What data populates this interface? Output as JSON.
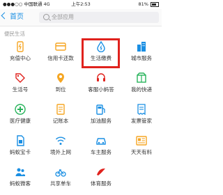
{
  "status_bar": {
    "carrier": "中国联通",
    "network": "4G",
    "time": "上午2:53",
    "battery": "81%"
  },
  "nav": {
    "back_label": "首页",
    "search_placeholder": "全部应用"
  },
  "section": {
    "title": "便民生活"
  },
  "colors": {
    "accent": "#1a8fe3",
    "orange": "#f5a623",
    "red": "#e0221d",
    "green": "#27b35b",
    "highlight": "#e0221d"
  },
  "apps": [
    {
      "label": "充值中心",
      "icon": "phone-charge-icon",
      "color": "#f5a623"
    },
    {
      "label": "信用卡还款",
      "icon": "credit-card-icon",
      "color": "#f5a623"
    },
    {
      "label": "生活缴费",
      "icon": "water-drop-icon",
      "color": "#1a8fe3"
    },
    {
      "label": "城市服务",
      "icon": "city-building-icon",
      "color": "#1a8fe3"
    },
    {
      "label": "生活号",
      "icon": "tag-icon",
      "color": "#e0221d"
    },
    {
      "label": "到位",
      "icon": "location-pin-icon",
      "color": "#f5a623"
    },
    {
      "label": "客服小蚂答",
      "icon": "headset-icon",
      "color": "#e0221d"
    },
    {
      "label": "我的快递",
      "icon": "package-icon",
      "color": "#27b35b"
    },
    {
      "label": "医疗健康",
      "icon": "medical-plus-icon",
      "color": "#27b35b"
    },
    {
      "label": "记账本",
      "icon": "notebook-icon",
      "color": "#f5a623"
    },
    {
      "label": "加油服务",
      "icon": "fuel-pump-icon",
      "color": "#1a8fe3"
    },
    {
      "label": "发票管家",
      "icon": "invoice-icon",
      "color": "#1a8fe3"
    },
    {
      "label": "蚂蚁宝卡",
      "icon": "sim-card-icon",
      "color": "#1a8fe3"
    },
    {
      "label": "境外上网",
      "icon": "wifi-icon",
      "color": "#1a8fe3"
    },
    {
      "label": "车主服务",
      "icon": "car-icon",
      "color": "#1a8fe3"
    },
    {
      "label": "天天有料",
      "icon": "news-icon",
      "color": "#f5a623"
    },
    {
      "label": "蚂蚁微客",
      "icon": "people-icon",
      "color": "#1a8fe3"
    },
    {
      "label": "共享单车",
      "icon": "bicycle-icon",
      "color": "#1a8fe3"
    },
    {
      "label": "体育服务",
      "icon": "sport-icon",
      "color": "#e0221d"
    },
    {
      "label": "",
      "icon": "",
      "color": "#ffffff"
    }
  ]
}
